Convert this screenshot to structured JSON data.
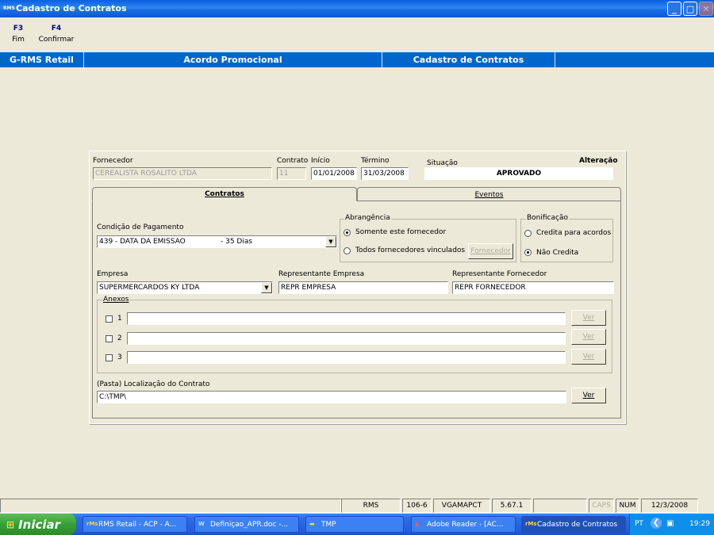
{
  "window": {
    "icon_text": "RMS",
    "title": "Cadastro de Contratos",
    "min": "_",
    "max": "□",
    "close": "✕"
  },
  "fkeys": [
    {
      "key": "F3",
      "label": "Fim"
    },
    {
      "key": "F4",
      "label": "Confirmar"
    }
  ],
  "header": {
    "app": "G-RMS Retail",
    "module": "Acordo Promocional",
    "screen": "Cadastro de Contratos"
  },
  "form": {
    "fornecedor_label": "Fornecedor",
    "fornecedor_value": "CEREALISTA ROSALITO LTDA",
    "contrato_label": "Contrato",
    "contrato_value": "11",
    "inicio_label": "Início",
    "inicio_value": "01/01/2008",
    "termino_label": "Término",
    "termino_value": "31/03/2008",
    "situacao_label": "Situação",
    "situacao_value": "APROVADO",
    "mode": "Alteração",
    "tabs": [
      "Contratos",
      "Eventos"
    ],
    "condicao_label": "Condição de Pagamento",
    "condicao_value": "439 - DATA DA EMISSAO",
    "condicao_days": "- 35 Dias",
    "abrangencia": {
      "label": "Abrangência",
      "opt1": "Somente este fornecedor",
      "opt2": "Todos fornecedores vinculados",
      "button": "Fornecedor",
      "selected": "opt1"
    },
    "bonificacao": {
      "label": "Bonificação",
      "opt1": "Credita para acordos",
      "opt2": "Não Credita",
      "selected": "opt2"
    },
    "empresa_label": "Empresa",
    "empresa_value": "SUPERMERCARDOS KY LTDA",
    "rep_empresa_label": "Representante Empresa",
    "rep_empresa_value": "REPR EMPRESA",
    "rep_fornecedor_label": "Representante Fornecedor",
    "rep_fornecedor_value": "REPR FORNECEDOR",
    "anexos_label": "Anexos",
    "anexos": [
      {
        "num": "1",
        "button": "Ver"
      },
      {
        "num": "2",
        "button": "Ver"
      },
      {
        "num": "3",
        "button": "Ver"
      }
    ],
    "local_label": "(Pasta)  Localização do Contrato",
    "local_value": "C:\\TMP\\",
    "local_button": "Ver"
  },
  "status": {
    "system": "RMS",
    "code": "106-6",
    "user": "VGAMAPCT",
    "version": "5.67.1",
    "caps": "CAPS",
    "num": "NUM",
    "date": "12/3/2008"
  },
  "taskbar": {
    "start": "Iniciar",
    "tasks": [
      "RMS Retail - ACP - A...",
      "Definiçao_APR.doc -...",
      "TMP",
      "Adobe Reader - [AC...",
      "Cadastro de Contratos"
    ],
    "lang": "PT",
    "time": "19:29"
  }
}
